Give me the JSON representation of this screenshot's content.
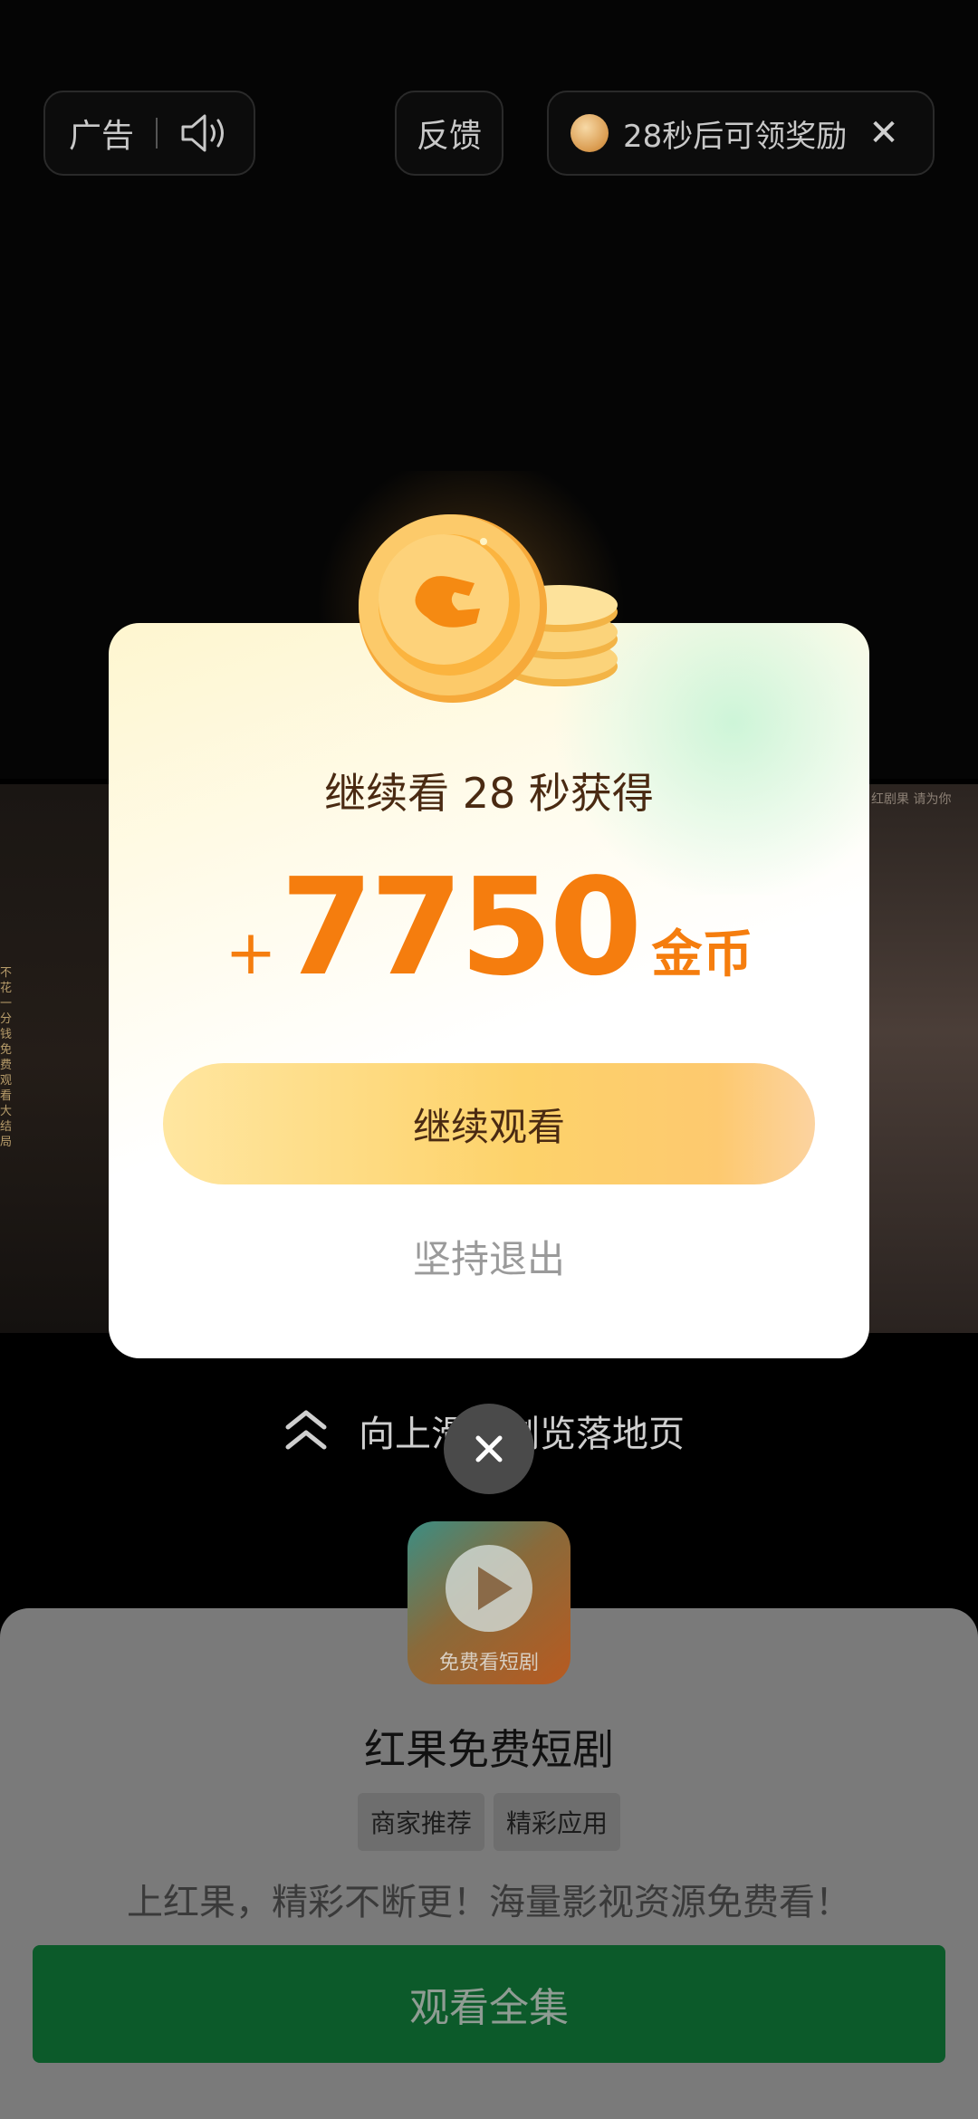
{
  "top_bar": {
    "ad_label": "广告",
    "feedback_label": "反馈",
    "reward_countdown": "28秒后可领奖励",
    "close_glyph": "✕"
  },
  "background": {
    "left_frame_text": "不花一分钱免费观看大结局",
    "right_frame_text": "红剧果 请为你"
  },
  "dialog": {
    "title": "继续看 28 秒获得",
    "reward_prefix": "+",
    "reward_amount": "7750",
    "reward_unit": "金币",
    "continue_label": "继续观看",
    "exit_label": "坚持退出"
  },
  "swipe_hint": "向上滑动浏览落地页",
  "app": {
    "icon_text": "免费看短剧",
    "name": "红果免费短剧",
    "tags": [
      "商家推荐",
      "精彩应用"
    ],
    "description": "上红果，精彩不断更！海量影视资源免费看！",
    "cta_label": "观看全集"
  },
  "colors": {
    "accent_orange": "#f57d0e",
    "cta_green": "#0c5a2a"
  }
}
